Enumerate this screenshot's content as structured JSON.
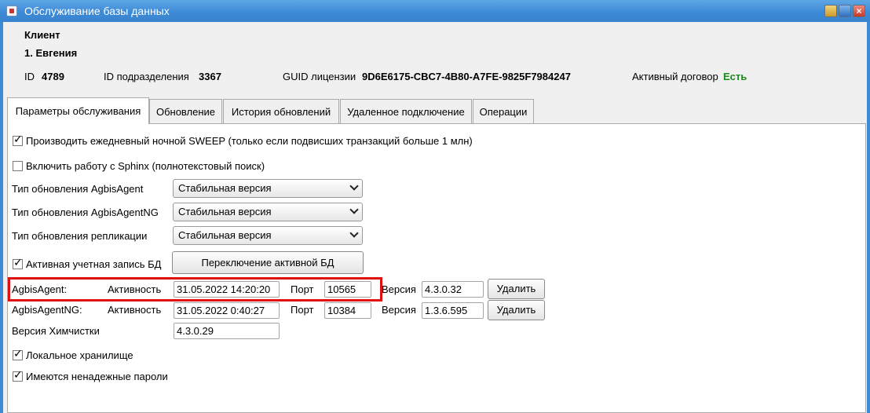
{
  "window": {
    "title": "Обслуживание базы данных"
  },
  "client": {
    "heading": "Клиент",
    "name": "1. Евгения",
    "id_label": "ID",
    "id_value": "4789",
    "dept_label": "ID подразделения",
    "dept_value": "3367",
    "guid_label": "GUID лицензии",
    "guid_value": "9D6E6175-CBC7-4B80-A7FE-9825F7984247",
    "contract_label": "Активный договор",
    "contract_value": "Есть"
  },
  "colors": {
    "accent": "#3d8ad6",
    "highlight": "#e01010",
    "status_ok": "#1a8c1a"
  },
  "tabs": [
    {
      "label": "Параметры обслуживания",
      "active": true
    },
    {
      "label": "Обновление",
      "active": false
    },
    {
      "label": "История обновлений",
      "active": false
    },
    {
      "label": "Удаленное подключение",
      "active": false
    },
    {
      "label": "Операции",
      "active": false
    }
  ],
  "settings": {
    "sweep": {
      "label": "Производить ежедневный ночной SWEEP (только если подвисших транзакций больше 1 млн)",
      "checked": true
    },
    "sphinx": {
      "label": "Включить работу с Sphinx (полнотекстовый поиск)",
      "checked": false
    },
    "agent_update": {
      "label": "Тип обновления AgbisAgent",
      "value": "Стабильная версия"
    },
    "agentng_update": {
      "label": "Тип обновления AgbisAgentNG",
      "value": "Стабильная версия"
    },
    "replication_update": {
      "label": "Тип обновления репликации",
      "value": "Стабильная версия"
    },
    "active_account": {
      "label": "Активная учетная запись БД",
      "checked": true
    },
    "switch_db_button": "Переключение активной БД",
    "agent": {
      "name": "AgbisAgent:",
      "activity_label": "Активность",
      "activity_value": "31.05.2022 14:20:20",
      "port_label": "Порт",
      "port_value": "10565",
      "version_label": "Версия",
      "version_value": "4.3.0.32",
      "delete_button": "Удалить"
    },
    "agentng": {
      "name": "AgbisAgentNG:",
      "activity_label": "Активность",
      "activity_value": "31.05.2022 0:40:27",
      "port_label": "Порт",
      "port_value": "10384",
      "version_label": "Версия",
      "version_value": "1.3.6.595",
      "delete_button": "Удалить"
    },
    "drycleaning": {
      "label": "Версия Химчистки",
      "value": "4.3.0.29"
    },
    "local_storage": {
      "label": "Локальное хранилище",
      "checked": true
    },
    "weak_passwords": {
      "label": "Имеются ненадежные пароли",
      "checked": true
    }
  }
}
